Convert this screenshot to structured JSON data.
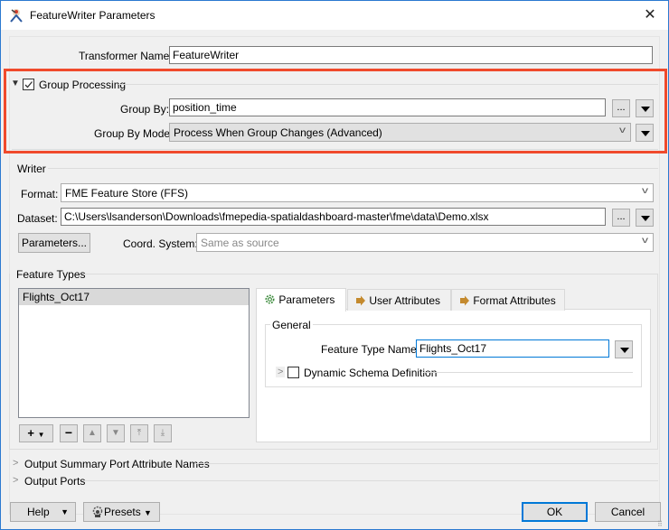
{
  "window": {
    "title": "FeatureWriter Parameters",
    "close_glyph": "✕"
  },
  "transformer": {
    "label": "Transformer Name:",
    "value": "FeatureWriter"
  },
  "group_processing": {
    "label": "Group Processing",
    "checked": true,
    "group_by_label": "Group By:",
    "group_by_value": "position_time",
    "group_by_mode_label": "Group By Mode:",
    "group_by_mode_value": "Process When Group Changes (Advanced)",
    "ellipsis": "..."
  },
  "writer": {
    "section_label": "Writer",
    "format_label": "Format:",
    "format_value": "FME Feature Store (FFS)",
    "dataset_label": "Dataset:",
    "dataset_value": "C:\\Users\\lsanderson\\Downloads\\fmepedia-spatialdashboard-master\\fme\\data\\Demo.xlsx",
    "parameters_button": "Parameters...",
    "coord_label": "Coord. System:",
    "coord_placeholder": "Same as source",
    "ellipsis": "..."
  },
  "feature_types": {
    "section_label": "Feature Types",
    "items": [
      "Flights_Oct17"
    ],
    "toolbar": {
      "add": "+",
      "remove": "−",
      "up": "▲",
      "down": "▼",
      "top": "⤒",
      "bottom": "⤓"
    },
    "tabs": [
      {
        "label": "Parameters",
        "icon": "gear-icon",
        "active": true
      },
      {
        "label": "User Attributes",
        "icon": "arrow-icon",
        "active": false
      },
      {
        "label": "Format Attributes",
        "icon": "arrow-icon",
        "active": false
      }
    ],
    "general_label": "General",
    "feature_type_name_label": "Feature Type Name:",
    "feature_type_name_value": "Flights_Oct17",
    "dynamic_schema_label": "Dynamic Schema Definition",
    "dynamic_schema_checked": false
  },
  "collapsed_sections": [
    {
      "label": "Output Summary Port Attribute Names"
    },
    {
      "label": "Output Ports"
    }
  ],
  "footer": {
    "help": "Help",
    "presets": "Presets",
    "ok": "OK",
    "cancel": "Cancel"
  },
  "colors": {
    "highlight": "#f04a2c",
    "focus_border": "#0078d7",
    "window_border": "#2b79d0"
  }
}
